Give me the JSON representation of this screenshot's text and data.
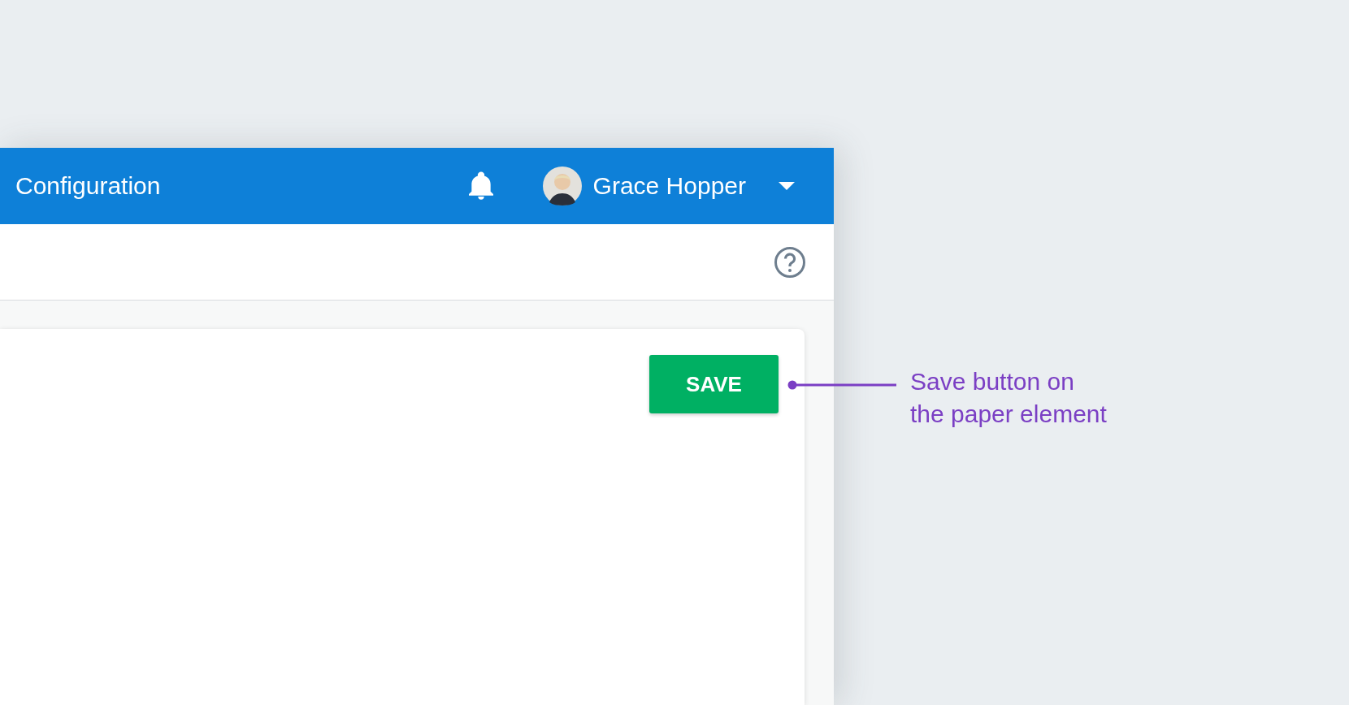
{
  "header": {
    "title": "Configuration",
    "user_name": "Grace Hopper"
  },
  "paper": {
    "save_button": "SAVE"
  },
  "annotation": {
    "text": "Save button on\nthe paper element"
  }
}
